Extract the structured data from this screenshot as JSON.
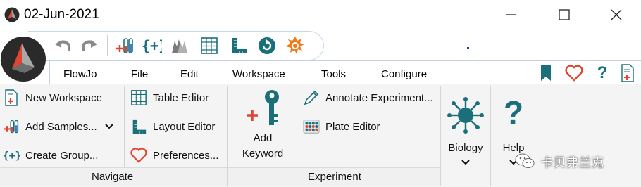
{
  "window": {
    "title": "02-Jun-2021",
    "controls": [
      "minimize",
      "maximize",
      "close"
    ]
  },
  "quick_access": {
    "items": [
      {
        "name": "undo",
        "icon": "undo-icon"
      },
      {
        "name": "redo",
        "icon": "redo-icon"
      },
      {
        "name": "add-samples",
        "icon": "test-tubes-plus-icon"
      },
      {
        "name": "create-group",
        "icon": "braces-plus-icon"
      },
      {
        "name": "overlay",
        "icon": "overlay-histogram-icon"
      },
      {
        "name": "table-editor",
        "icon": "table-grid-icon"
      },
      {
        "name": "layout-editor",
        "icon": "layout-ruler-icon"
      },
      {
        "name": "refresh",
        "icon": "refresh-circle-icon"
      },
      {
        "name": "burst",
        "icon": "orange-burst-icon"
      }
    ]
  },
  "menu": {
    "items": [
      "FlowJo",
      "File",
      "Edit",
      "Workspace",
      "Tools",
      "Configure"
    ],
    "active": "FlowJo",
    "right_icons": [
      "bookmark-icon",
      "heart-icon",
      "help-question-icon",
      "add-document-icon"
    ],
    "right_help_glyph": "?"
  },
  "ribbon": {
    "groups": [
      {
        "label": "Navigate",
        "buttons": [
          {
            "label": "New Workspace",
            "icon": "new-workspace-icon"
          },
          {
            "label": "Add Samples...",
            "icon": "add-samples-icon",
            "has_dropdown": true
          },
          {
            "label": "Create Group...",
            "icon": "create-group-icon"
          },
          {
            "label": "Table Editor",
            "icon": "table-editor-icon"
          },
          {
            "label": "Layout Editor",
            "icon": "layout-editor-icon"
          },
          {
            "label": "Preferences...",
            "icon": "heart-icon"
          }
        ]
      },
      {
        "label": "Experiment",
        "big_button": {
          "label_line1": "Add",
          "label_line2": "Keyword",
          "icon": "add-keyword-icon"
        },
        "buttons": [
          {
            "label": "Annotate Experiment...",
            "icon": "pen-icon"
          },
          {
            "label": "Plate Editor",
            "icon": "plate-icon"
          }
        ]
      },
      {
        "label": "",
        "big_button": {
          "label": "Biology",
          "icon": "biology-virus-icon",
          "has_dropdown": true
        }
      },
      {
        "label": "",
        "big_button": {
          "label": "Help",
          "icon": "help-question-icon",
          "has_dropdown": true,
          "glyph": "?"
        }
      }
    ]
  },
  "watermark": {
    "text": "卡贝弗兰克",
    "icon": "wechat-icon"
  },
  "colors": {
    "accent_red": "#e2452f",
    "accent_teal": "#1a6f7a",
    "accent_orange": "#f07a1a",
    "ribbon_bg": "#f4f4f4"
  }
}
